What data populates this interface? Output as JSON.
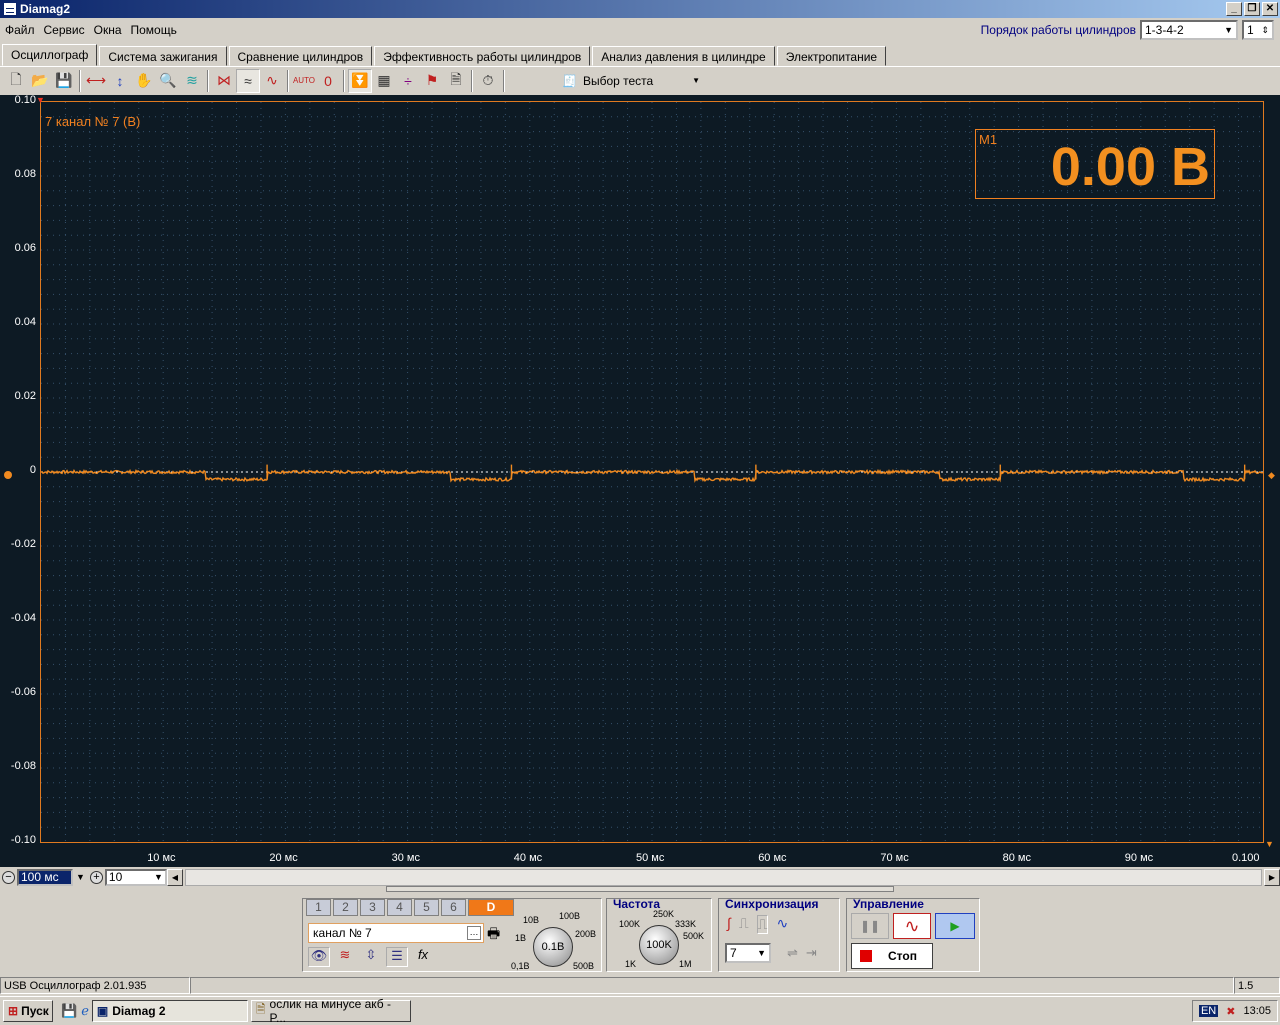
{
  "window": {
    "title": "Diamag2"
  },
  "menu": [
    "Файл",
    "Сервис",
    "Окна",
    "Помощь"
  ],
  "cylinders": {
    "label": "Порядок работы цилиндров",
    "order": "1-3-4-2",
    "count": "1"
  },
  "tabs": [
    "Осциллограф",
    "Система зажигания",
    "Сравнение цилиндров",
    "Эффективность работы цилиндров",
    "Анализ давления в цилиндре",
    "Электропитание"
  ],
  "toolbar": {
    "test_select": "Выбор теста",
    "auto_label": "AUTO",
    "zero_label": "0"
  },
  "scope": {
    "channel_label": "7  канал № 7 (В)",
    "meter_name": "M1",
    "meter_value": "0.00 В",
    "y_ticks": [
      "0.10",
      "0.08",
      "0.06",
      "0.04",
      "0.02",
      "0",
      "-0.02",
      "-0.04",
      "-0.06",
      "-0.08",
      "-0.10"
    ],
    "x_ticks": [
      "10 мс",
      "20 мс",
      "30 мс",
      "40 мс",
      "50 мс",
      "60 мс",
      "70 мс",
      "80 мс",
      "90 мс",
      "0.100"
    ],
    "trace_color": "#f08a20",
    "pulse_starts_ms": [
      13.5,
      33.5,
      53.5,
      73.5,
      93.5
    ],
    "pulse_width_ms": 5,
    "pulse_level": -0.002
  },
  "scrollbar": {
    "timebase": "100 мс",
    "zoom": "10"
  },
  "controls": {
    "channels": [
      "1",
      "2",
      "3",
      "4",
      "5",
      "6",
      "D"
    ],
    "channel_name": "канал № 7",
    "fx_label": "fx",
    "volt_title": "",
    "volt_labels": [
      "10В",
      "100В",
      "1В",
      "200В",
      "0,1В",
      "500В"
    ],
    "volt_value": "0.1В",
    "freq_title": "Частота",
    "freq_labels": [
      "250K",
      "100K",
      "333K",
      "500K",
      "1K",
      "1M"
    ],
    "freq_value": "100K",
    "sync_title": "Синхронизация",
    "sync_channel": "7",
    "ctrl_title": "Управление",
    "stop_label": "Стоп"
  },
  "status": {
    "left": "USB Осциллограф  2.01.935",
    "right": "1.5"
  },
  "taskbar": {
    "start": "Пуск",
    "app": "Diamag 2",
    "other": "ослик на минусе акб - P...",
    "lang": "EN",
    "time": "13:05"
  }
}
